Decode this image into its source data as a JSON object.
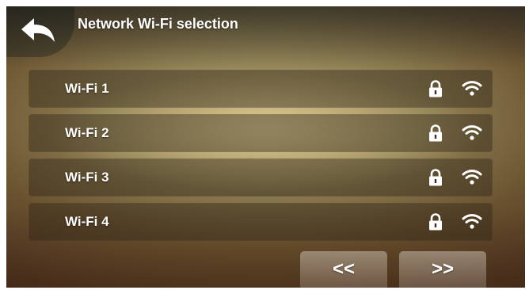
{
  "header": {
    "title": "Network Wi-Fi selection",
    "back_icon": "back-arrow-icon"
  },
  "networks": [
    {
      "name": "Wi-Fi 1",
      "secured": true,
      "signal_icon": "wifi-icon"
    },
    {
      "name": "Wi-Fi 2",
      "secured": true,
      "signal_icon": "wifi-icon"
    },
    {
      "name": "Wi-Fi 3",
      "secured": true,
      "signal_icon": "wifi-icon"
    },
    {
      "name": "Wi-Fi 4",
      "secured": true,
      "signal_icon": "wifi-icon"
    }
  ],
  "pagination": {
    "prev_label": "<<",
    "next_label": ">>"
  }
}
